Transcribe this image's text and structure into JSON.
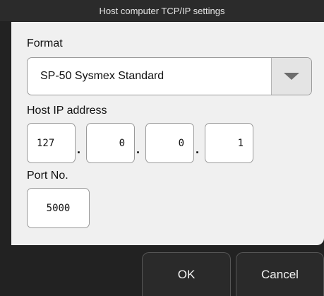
{
  "dialog": {
    "title": "Host computer TCP/IP settings"
  },
  "format": {
    "label": "Format",
    "selected": "SP-50 Sysmex Standard",
    "dropdown_icon": "triangle-down-icon"
  },
  "host_ip": {
    "label": "Host IP address",
    "octets": [
      "127",
      "0",
      "0",
      "1"
    ],
    "separator": "."
  },
  "port": {
    "label": "Port No.",
    "value": "5000"
  },
  "buttons": {
    "ok": "OK",
    "cancel": "Cancel"
  }
}
